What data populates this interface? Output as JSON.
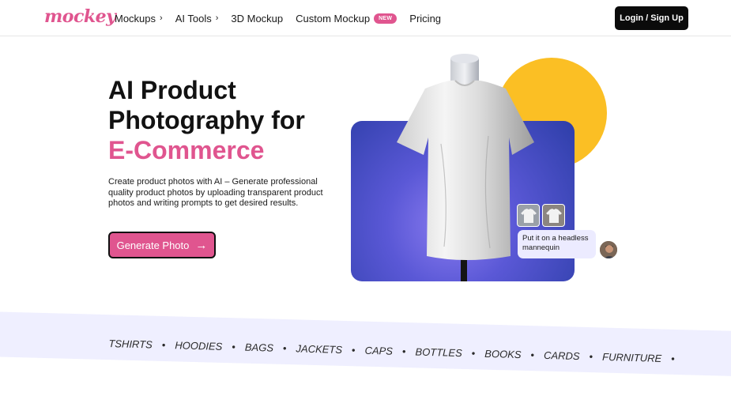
{
  "brand": {
    "logo_text": "mockey",
    "accent": "#e0558f"
  },
  "nav": {
    "items": [
      {
        "label": "Mockups",
        "has_chevron": true
      },
      {
        "label": "AI Tools",
        "has_chevron": true
      },
      {
        "label": "3D Mockup",
        "has_chevron": false
      },
      {
        "label": "Custom Mockup",
        "has_chevron": false,
        "badge": "NEW"
      },
      {
        "label": "Pricing",
        "has_chevron": false
      }
    ],
    "chevron": "›",
    "login_label": "Login / Sign Up"
  },
  "hero": {
    "title_line1": "AI Product",
    "title_line2": "Photography for",
    "title_accent": "E-Commerce",
    "description": "Create product photos with AI – Generate professional quality product photos by uploading transparent product photos and writing prompts to get desired results.",
    "cta_label": "Generate Photo",
    "cta_arrow": "→"
  },
  "visual": {
    "prompt_bubble": "Put it on a headless mannequin",
    "colors": {
      "yellow": "#fbbf24",
      "card": "#5a58d6"
    }
  },
  "categories": [
    "TSHIRTS",
    "HOODIES",
    "BAGS",
    "JACKETS",
    "CAPS",
    "BOTTLES",
    "BOOKS",
    "CARDS",
    "FURNITURE"
  ],
  "separator": "•"
}
